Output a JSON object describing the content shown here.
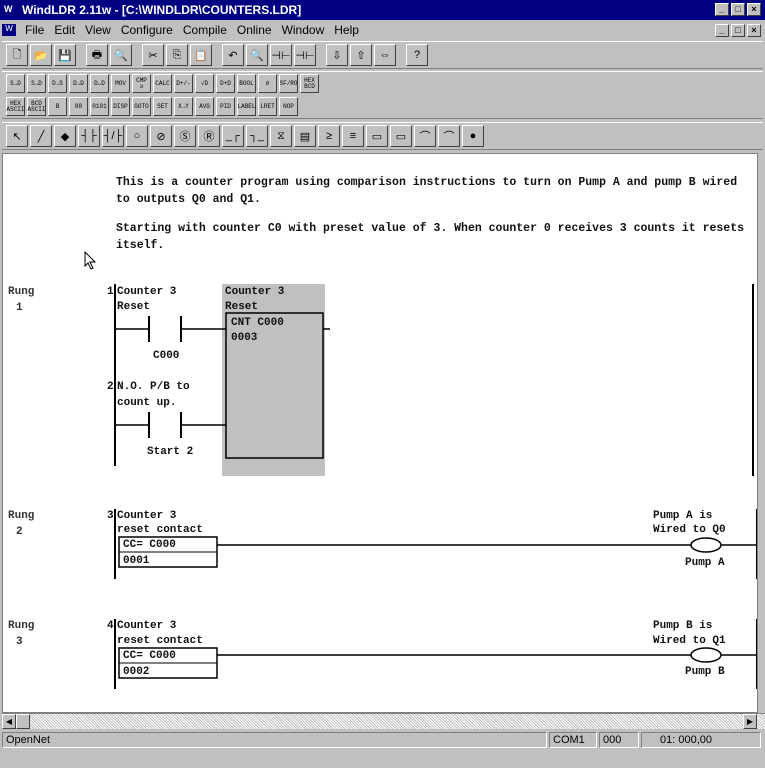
{
  "window": {
    "title": "WindLDR 2.11w - [C:\\WINDLDR\\COUNTERS.LDR]",
    "app_icon": "W"
  },
  "menu": [
    "File",
    "Edit",
    "View",
    "Configure",
    "Compile",
    "Online",
    "Window",
    "Help"
  ],
  "toolbar1": [
    "new",
    "open",
    "save",
    "print",
    "print-preview",
    "cut",
    "copy",
    "paste",
    "undo",
    "find",
    "monitor",
    "download",
    "upload",
    "compare",
    "help"
  ],
  "toolbar2_row1": [
    "S→D",
    "S→D",
    "D→S",
    "D→D",
    "D↔D",
    "MOV",
    "CMP ≥",
    "CALC",
    "D+/-",
    "√D",
    "D+D",
    "BOOL",
    "∅",
    "SF/RO",
    "HEX BCD"
  ],
  "toolbar2_row2": [
    "HEX ASCII",
    "BCD ASCII",
    "B",
    "88",
    "0101",
    "DISP",
    "GOTO",
    "SET",
    "X→Y",
    "AVG",
    "PID",
    "LABEL",
    "LRET",
    "NOP"
  ],
  "toolbar3": [
    "select",
    "line",
    "erase",
    "NO",
    "NC",
    "coil",
    "inv-coil",
    "set",
    "reset",
    "SOTU",
    "SOTD",
    "TIM",
    "CNT",
    "CMP",
    "SFR",
    "MCS",
    "MCR",
    "JMP",
    "JEND",
    "END"
  ],
  "program": {
    "comment1": "This is a counter program using comparison instructions to turn on Pump A and pump B wired to outputs Q0 and Q1.",
    "comment2": "Starting with counter C0 with preset value of 3. When counter 0  receives 3 counts it resets itself.",
    "rungs": [
      {
        "label": "Rung",
        "number": "1",
        "inputs": [
          {
            "index": "1",
            "line1": "Counter 3",
            "line2": "Reset",
            "operand": "C000"
          },
          {
            "index": "2",
            "line1": "N.O. P/B to",
            "line2": "count up.",
            "operand": "Start 2"
          }
        ],
        "block": {
          "line1": "Counter 3",
          "line2": "Reset",
          "instr": "CNT C000",
          "preset": "0003"
        }
      },
      {
        "label": "Rung",
        "number": "2",
        "input": {
          "index": "3",
          "line1": "Counter 3",
          "line2": "reset contact",
          "compare": "CC= C000",
          "value": "0001"
        },
        "output": {
          "line1": "Pump A is",
          "line2": "Wired to Q0",
          "name": "Pump A"
        }
      },
      {
        "label": "Rung",
        "number": "3",
        "input": {
          "index": "4",
          "line1": "Counter 3",
          "line2": "reset contact",
          "compare": "CC= C000",
          "value": "0002"
        },
        "output": {
          "line1": "Pump B is",
          "line2": "Wired to Q1",
          "name": "Pump B"
        }
      }
    ]
  },
  "status": {
    "connection": "OpenNet",
    "port": "COM1",
    "station": "000",
    "position": "01: 000,00"
  }
}
